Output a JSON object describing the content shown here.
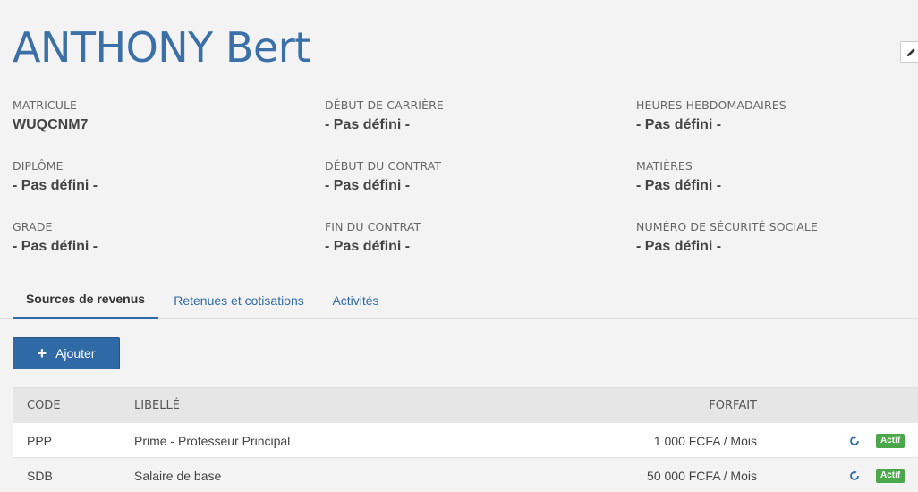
{
  "employee": {
    "name": "ANTHONY Bert"
  },
  "fields": [
    {
      "label": "MATRICULE",
      "value": "WUQCNM7"
    },
    {
      "label": "DÉBUT DE CARRIÈRE",
      "value": "- Pas défini -"
    },
    {
      "label": "HEURES HEBDOMADAIRES",
      "value": "- Pas défini -"
    },
    {
      "label": "DIPLÔME",
      "value": "- Pas défini -"
    },
    {
      "label": "DÉBUT DU CONTRAT",
      "value": "- Pas défini -"
    },
    {
      "label": "MATIÈRES",
      "value": "- Pas défini -"
    },
    {
      "label": "GRADE",
      "value": "- Pas défini -"
    },
    {
      "label": "FIN DU CONTRAT",
      "value": "- Pas défini -"
    },
    {
      "label": "NUMÉRO DE SÉCURITÉ SOCIALE",
      "value": "- Pas défini -"
    }
  ],
  "tabs": [
    {
      "label": "Sources de revenus",
      "active": true
    },
    {
      "label": "Retenues et cotisations",
      "active": false
    },
    {
      "label": "Activités",
      "active": false
    }
  ],
  "add_button": {
    "label": "Ajouter",
    "icon": "plus-icon"
  },
  "table": {
    "headers": {
      "code": "CODE",
      "libelle": "LIBELLÉ",
      "forfait": "FORFAIT"
    },
    "rows": [
      {
        "code": "PPP",
        "libelle": "Prime - Professeur Principal",
        "forfait": "1 000 FCFA  / Mois",
        "status": "Actif"
      },
      {
        "code": "SDB",
        "libelle": "Salaire de base",
        "forfait": "50 000 FCFA  / Mois",
        "status": "Actif"
      }
    ]
  },
  "colors": {
    "accent": "#2f6aa7",
    "title": "#3a6fa8",
    "badge": "#4aa84a"
  }
}
